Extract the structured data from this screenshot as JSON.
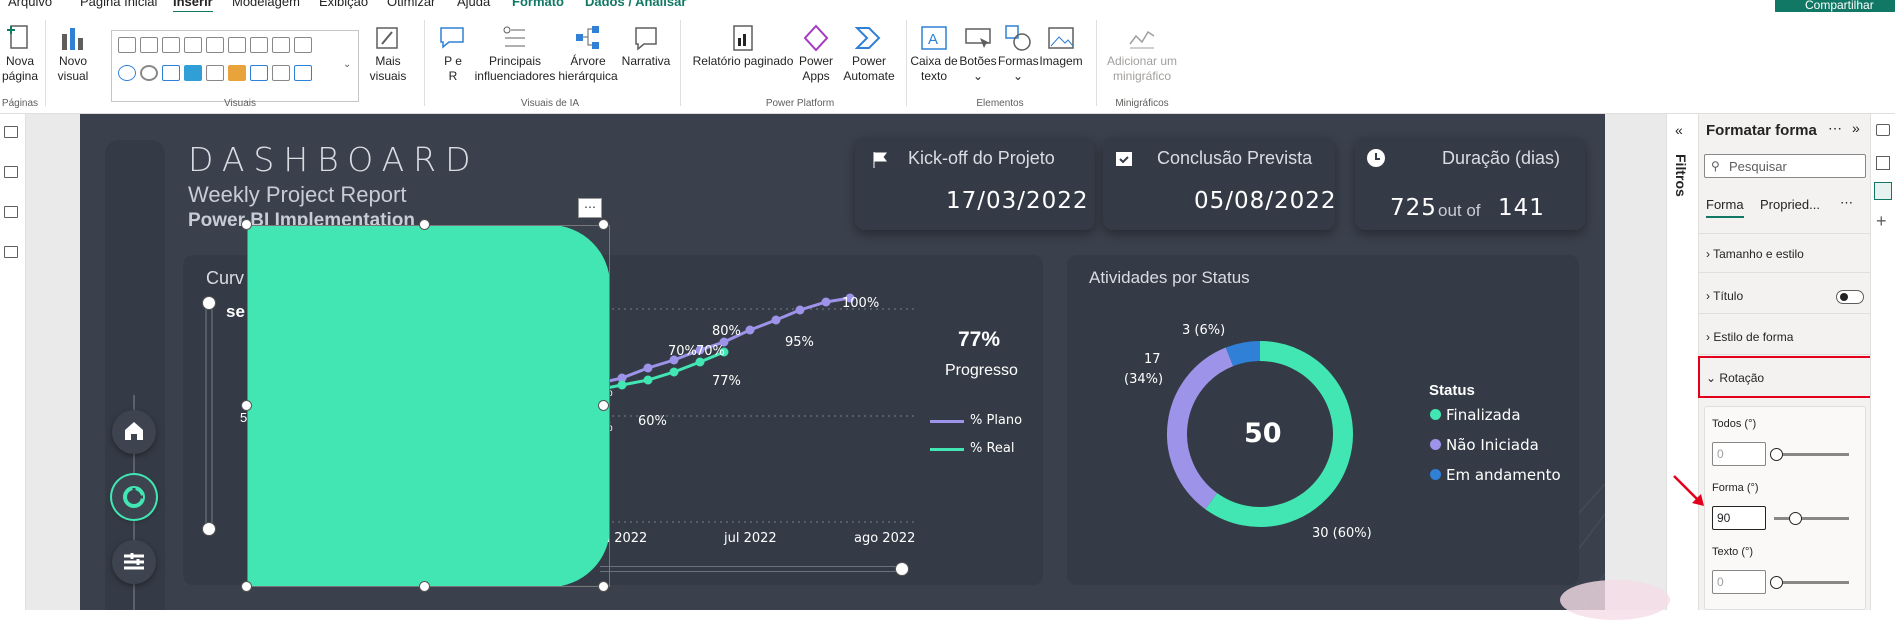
{
  "menu": {
    "tabs": [
      "Arquivo",
      "Página Inicial",
      "Inserir",
      "Modelagem",
      "Exibição",
      "Otimizar",
      "Ajuda",
      "Formato",
      "Dados / Analisar"
    ],
    "share_label": "Compartilhar"
  },
  "ribbon": {
    "new_page": [
      "Nova",
      "página"
    ],
    "new_visual": [
      "Novo",
      "visual"
    ],
    "more_visuals": [
      "Mais",
      "visuais"
    ],
    "qa": [
      "P e",
      "R"
    ],
    "key_influencers": [
      "Principais",
      "influenciadores"
    ],
    "decomp_tree": [
      "Árvore",
      "hierárquica"
    ],
    "narrative": [
      "Narrativa"
    ],
    "paginated": [
      "Relatório paginado"
    ],
    "power_apps": [
      "Power",
      "Apps"
    ],
    "power_automate": [
      "Power",
      "Automate"
    ],
    "textbox": [
      "Caixa de",
      "texto"
    ],
    "buttons": [
      "Botões"
    ],
    "shapes": [
      "Formas"
    ],
    "image": [
      "Imagem"
    ],
    "sparkline": [
      "Adicionar um",
      "minigráfico"
    ],
    "groups": {
      "pages": "Páginas",
      "visuals": "Visuais",
      "ai": "Visuais de IA",
      "platform": "Power Platform",
      "elements": "Elementos",
      "sparklines": "Minigráficos"
    }
  },
  "report": {
    "title": "DASHBOARD",
    "subtitle": "Weekly Project Report",
    "subtitle2": "Power BI Implementation",
    "kpis": [
      {
        "label": "Kick-off do Projeto",
        "value": "17/03/2022",
        "icon": "flag-icon"
      },
      {
        "label": "Conclusão Prevista",
        "value": "05/08/2022",
        "icon": "calendar-check-icon"
      },
      {
        "label": "Duração (dias)",
        "value_a": "725",
        "mid": "out of",
        "value_b": "141",
        "icon": "clock-icon"
      }
    ],
    "curve": {
      "title_partial": "Curv",
      "sub_partial": "se",
      "left_partial": "5",
      "pct_partial1": "%",
      "pct_partial2": "%",
      "progress_value": "77%",
      "progress_label": "Progresso",
      "legend": [
        {
          "name": "% Plano",
          "color": "#9d93e8"
        },
        {
          "name": "% Real",
          "color": "#41e6b3"
        }
      ]
    },
    "status": {
      "title": "Atividades por Status",
      "total": "50",
      "legend_title": "Status",
      "labels": {
        "andamento": "3 (6%)",
        "nao_iniciada_a": "17",
        "nao_iniciada_b": "(34%)",
        "finalizada": "30 (60%)"
      }
    },
    "chart_data": [
      {
        "type": "line",
        "title": "",
        "x": [
          "jun 2022",
          "jul 2022",
          "ago 2022"
        ],
        "series": [
          {
            "name": "% Plano",
            "values": [
              null,
              null,
              null,
              null,
              "70%",
              "70%",
              "80%",
              null,
              "95%",
              "100%"
            ]
          },
          {
            "name": "% Real",
            "values": [
              "60%",
              null,
              null,
              null,
              "77%"
            ]
          }
        ],
        "point_labels": [
          "60%",
          "70%",
          "70%",
          "80%",
          "77%",
          "95%",
          "100%"
        ]
      },
      {
        "type": "pie",
        "title": "Atividades por Status",
        "categories": [
          "Finalizada",
          "Não Iniciada",
          "Em andamento"
        ],
        "values": [
          30,
          17,
          3
        ],
        "colors": [
          "#41e6b3",
          "#9d93e8",
          "#2f80d6"
        ]
      }
    ]
  },
  "filters": {
    "label": "Filtros"
  },
  "format_pane": {
    "title": "Formatar forma",
    "search_placeholder": "Pesquisar",
    "tabs": [
      "Forma",
      "Propried..."
    ],
    "more": "⋯",
    "sections": [
      "Tamanho e estilo",
      "Título",
      "Estilo de forma",
      "Rotação"
    ],
    "rotation": {
      "all_label": "Todos (°)",
      "all_value": "0",
      "shape_label": "Forma (°)",
      "shape_value": "90",
      "text_label": "Texto (°)",
      "text_value": "0"
    }
  }
}
